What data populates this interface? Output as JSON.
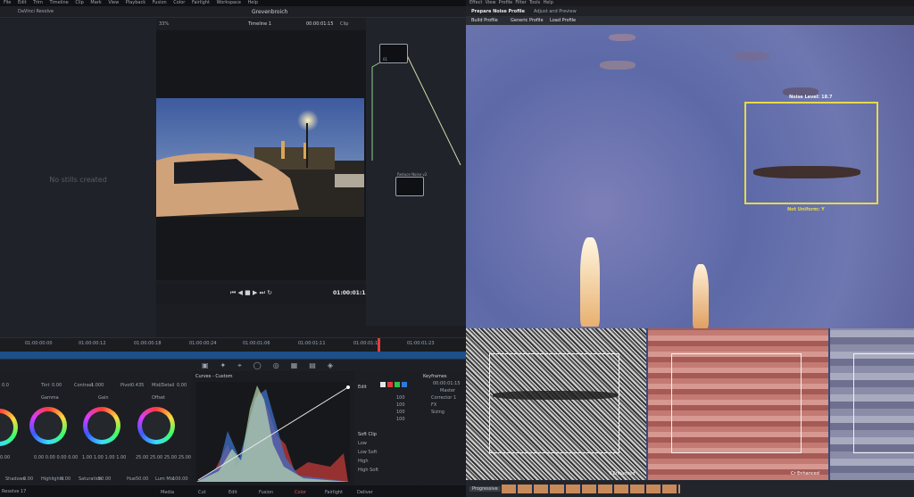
{
  "resolve": {
    "menu": [
      "DaVinci Resolve",
      "File",
      "Edit",
      "Trim",
      "Timeline",
      "Clip",
      "Mark",
      "View",
      "Playback",
      "Fusion",
      "Color",
      "Fairlight",
      "Workspace",
      "Help"
    ],
    "project_title": "Grevenbroich",
    "timeline_name": "Timeline 1",
    "timecode_top": "00:00:01:15",
    "clip_label": "Clip",
    "zoom": "33%",
    "gallery_empty": "No stills created",
    "timecode_viewer": "01:00:01:15",
    "node_labels": [
      "01",
      "Reduce Noise v2"
    ],
    "ruler_ticks": [
      "01:00:00:00",
      "01:00:00:12",
      "01:00:00:18",
      "01:00:00:24",
      "01:00:01:06",
      "01:00:01:11",
      "01:00:01:17",
      "01:00:01:23"
    ],
    "wheel_names": [
      "Gamma",
      "Gain",
      "Offset"
    ],
    "wheel_values": [
      [
        "0.00",
        "0.00",
        "0.00",
        "0.00"
      ],
      [
        "1.00",
        "1.00",
        "1.00",
        "1.00"
      ],
      [
        "25.00",
        "25.00",
        "25.00",
        "25.00"
      ]
    ],
    "wheel_top": {
      "temp_label": "Temp",
      "temp": "0.0",
      "tint_label": "Tint",
      "tint": "0.00",
      "contrast_label": "Contrast",
      "contrast": "1.000",
      "pivot_label": "Pivot",
      "pivot": "0.435",
      "mid_label": "Mid/Detail",
      "mid": "0.00"
    },
    "wheel_bottom": {
      "shadows_label": "Shadows",
      "shadows": "0.00",
      "highlights_label": "Highlights",
      "highlights": "0.00",
      "saturation_label": "Saturation",
      "saturation": "50.00",
      "hue_label": "Hue",
      "hue": "50.00",
      "lummix_label": "Lum Mix",
      "lummix": "100.00"
    },
    "curves_title": "Curves - Custom",
    "edit_title": "Edit",
    "edit_values": [
      "100",
      "100",
      "100",
      "100"
    ],
    "softclip_title": "Soft Clip",
    "softclip_items": [
      "Low",
      "Low Soft",
      "High",
      "High Soft"
    ],
    "keyframes_title": "Keyframes",
    "keyframes_time": "00:00:01:15",
    "keyframes_items": [
      "Master",
      "Corrector 1",
      "FX",
      "Sizing"
    ],
    "pages": [
      "Media",
      "Cut",
      "Edit",
      "Fusion",
      "Color",
      "Fairlight",
      "Deliver"
    ],
    "version": "Resolve 17"
  },
  "noise": {
    "menu": [
      "Effect",
      "View",
      "Profile",
      "Filter",
      "Tools",
      "Help"
    ],
    "tabs": [
      "Prepare Noise Profile",
      "Adjust and Preview"
    ],
    "buttons": [
      "Build Profile",
      "Generic Profile",
      "Load Profile"
    ],
    "noise_level": "Noise Level: 18.7",
    "not_uniform": "Not Uniform: Y",
    "panel_y": "Y Enhanced",
    "panel_cr": "Cr Enhanced",
    "bottom_label": "Progressive"
  },
  "colors": {
    "accent_yellow": "#e8d84a",
    "playhead": "#e23b3b"
  }
}
